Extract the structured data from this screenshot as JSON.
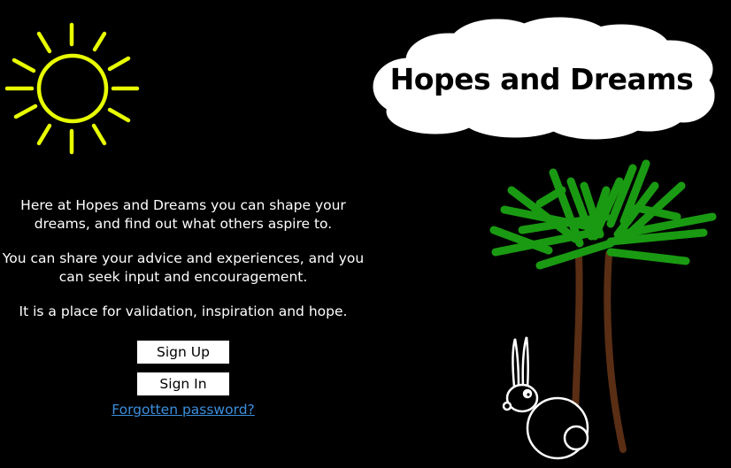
{
  "header": {
    "title": "Hopes and Dreams"
  },
  "intro": {
    "paragraphs": [
      "Here at Hopes and Dreams you can shape your dreams, and find out what others aspire to.",
      "You can share your advice and experiences, and you can seek input and encouragement.",
      "It is a place for validation, inspiration and hope."
    ]
  },
  "actions": {
    "sign_up_label": "Sign Up",
    "sign_in_label": "Sign In",
    "forgot_password_label": "Forgotten password?"
  },
  "colors": {
    "background": "#000000",
    "sun": "#e8ff00",
    "foliage": "#1a9a12",
    "trunk": "#5a2e14",
    "link": "#3b8fdd"
  },
  "icons": {
    "sun": "sun-icon",
    "cloud": "cloud-icon",
    "tree": "tree-icon",
    "rabbit": "rabbit-icon"
  }
}
